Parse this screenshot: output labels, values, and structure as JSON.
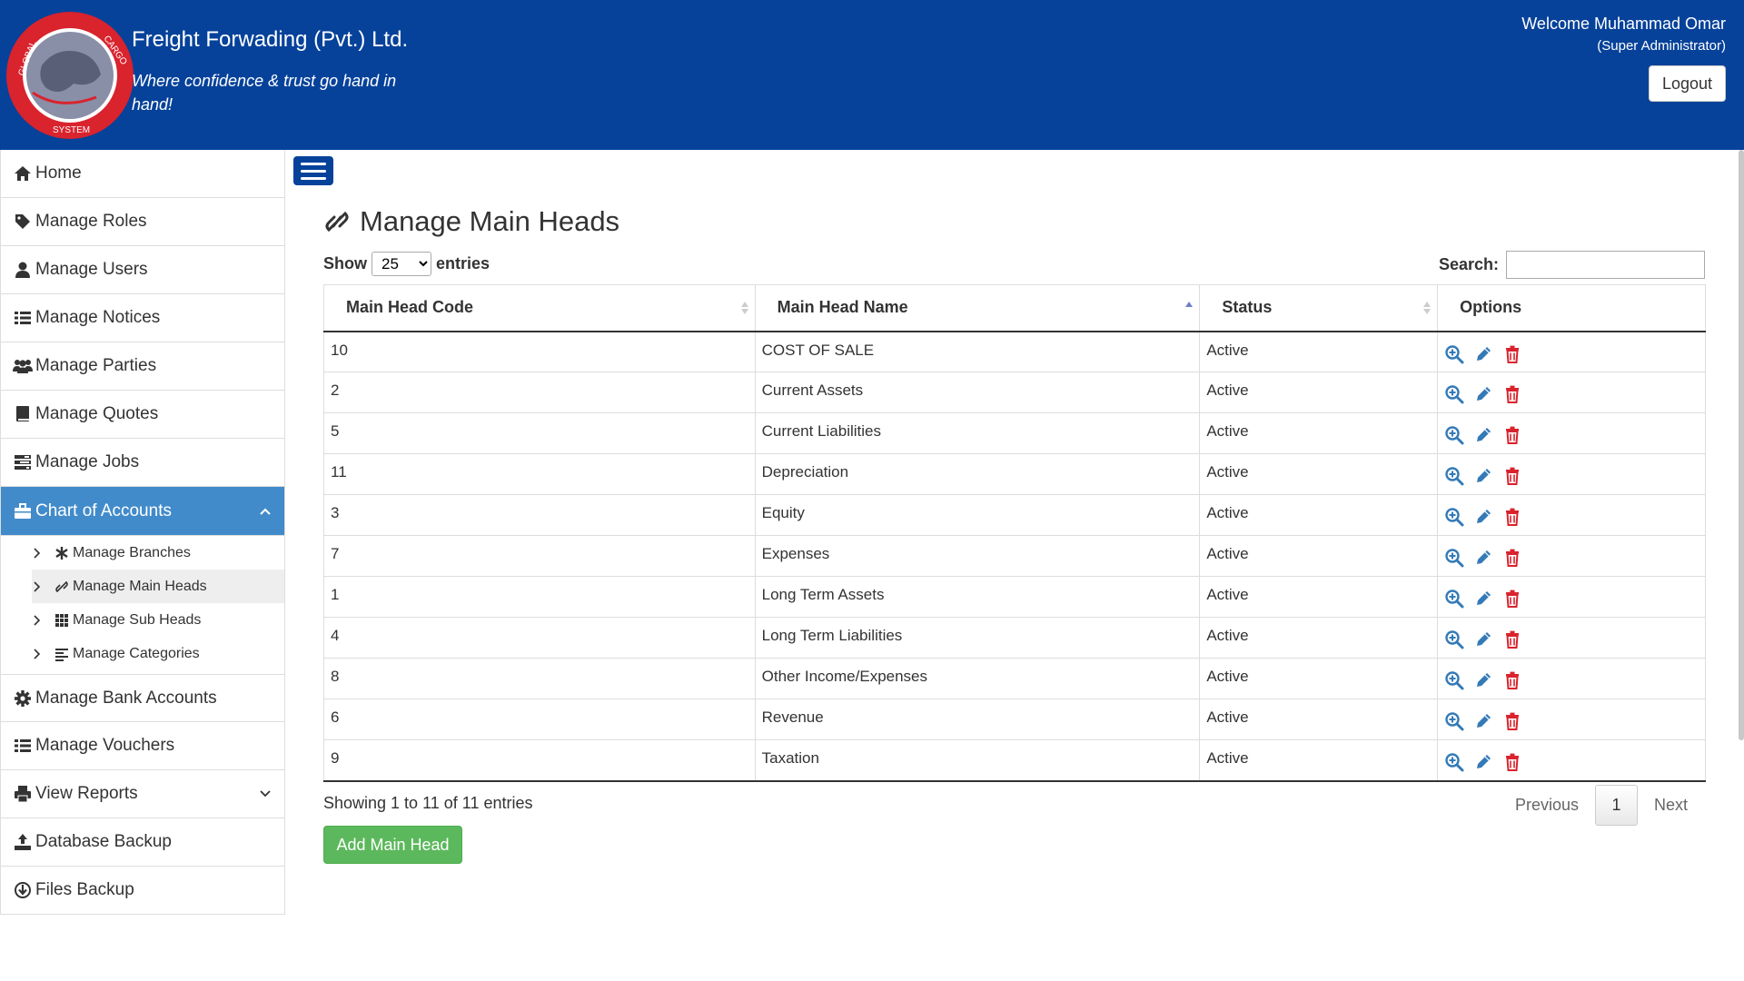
{
  "header": {
    "brand": "Freight Forwading (Pvt.) Ltd.",
    "tagline": "Where confidence & trust go hand in hand!",
    "welcome": "Welcome Muhammad Omar",
    "role": "(Super Administrator)",
    "logout_label": "Logout",
    "logo_text_top": "GLOBAL CARGO",
    "logo_text_bottom": "SYSTEM",
    "colors": {
      "header_bg": "#06429a",
      "logo_ring": "#d9232d"
    }
  },
  "sidebar": {
    "items": [
      {
        "label": "Home",
        "icon": "home-icon"
      },
      {
        "label": "Manage Roles",
        "icon": "tag-icon"
      },
      {
        "label": "Manage Users",
        "icon": "user-icon"
      },
      {
        "label": "Manage Notices",
        "icon": "list-icon"
      },
      {
        "label": "Manage Parties",
        "icon": "users-icon"
      },
      {
        "label": "Manage Quotes",
        "icon": "book-icon"
      },
      {
        "label": "Manage Jobs",
        "icon": "tasks-icon"
      },
      {
        "label": "Chart of Accounts",
        "icon": "briefcase-icon",
        "active": true,
        "expanded": true
      },
      {
        "label": "Manage Bank Accounts",
        "icon": "cog-icon"
      },
      {
        "label": "Manage Vouchers",
        "icon": "list-icon"
      },
      {
        "label": "View Reports",
        "icon": "print-icon",
        "has_dropdown": true
      },
      {
        "label": "Database Backup",
        "icon": "upload-icon"
      },
      {
        "label": "Files Backup",
        "icon": "download-circle-icon"
      }
    ],
    "submenu": [
      {
        "label": "Manage Branches",
        "icon": "asterisk-icon"
      },
      {
        "label": "Manage Main Heads",
        "icon": "link-icon",
        "active": true
      },
      {
        "label": "Manage Sub Heads",
        "icon": "grid-icon"
      },
      {
        "label": "Manage Categories",
        "icon": "align-left-icon"
      }
    ],
    "active_color": "#428bca"
  },
  "main": {
    "title": "Manage Main Heads",
    "show_label": "Show",
    "entries_label": "entries",
    "page_size": "25",
    "search_label": "Search:",
    "search_value": "",
    "columns": [
      "Main Head Code",
      "Main Head Name",
      "Status",
      "Options"
    ],
    "rows": [
      {
        "code": "10",
        "name": "COST OF SALE",
        "status": "Active"
      },
      {
        "code": "2",
        "name": "Current Assets",
        "status": "Active"
      },
      {
        "code": "5",
        "name": "Current Liabilities",
        "status": "Active"
      },
      {
        "code": "11",
        "name": "Depreciation",
        "status": "Active"
      },
      {
        "code": "3",
        "name": "Equity",
        "status": "Active"
      },
      {
        "code": "7",
        "name": "Expenses",
        "status": "Active"
      },
      {
        "code": "1",
        "name": "Long Term Assets",
        "status": "Active"
      },
      {
        "code": "4",
        "name": "Long Term Liabilities",
        "status": "Active"
      },
      {
        "code": "8",
        "name": "Other Income/Expenses",
        "status": "Active"
      },
      {
        "code": "6",
        "name": "Revenue",
        "status": "Active"
      },
      {
        "code": "9",
        "name": "Taxation",
        "status": "Active"
      }
    ],
    "option_icons": [
      "zoom-in-icon",
      "pencil-icon",
      "trash-icon"
    ],
    "showing_text": "Showing 1 to 11 of 11 entries",
    "pager": {
      "previous": "Previous",
      "current": "1",
      "next": "Next"
    },
    "add_button": "Add Main Head",
    "colors": {
      "view": "#337ab7",
      "edit": "#337ab7",
      "delete": "#d9232d",
      "add": "#5cb85c"
    }
  }
}
